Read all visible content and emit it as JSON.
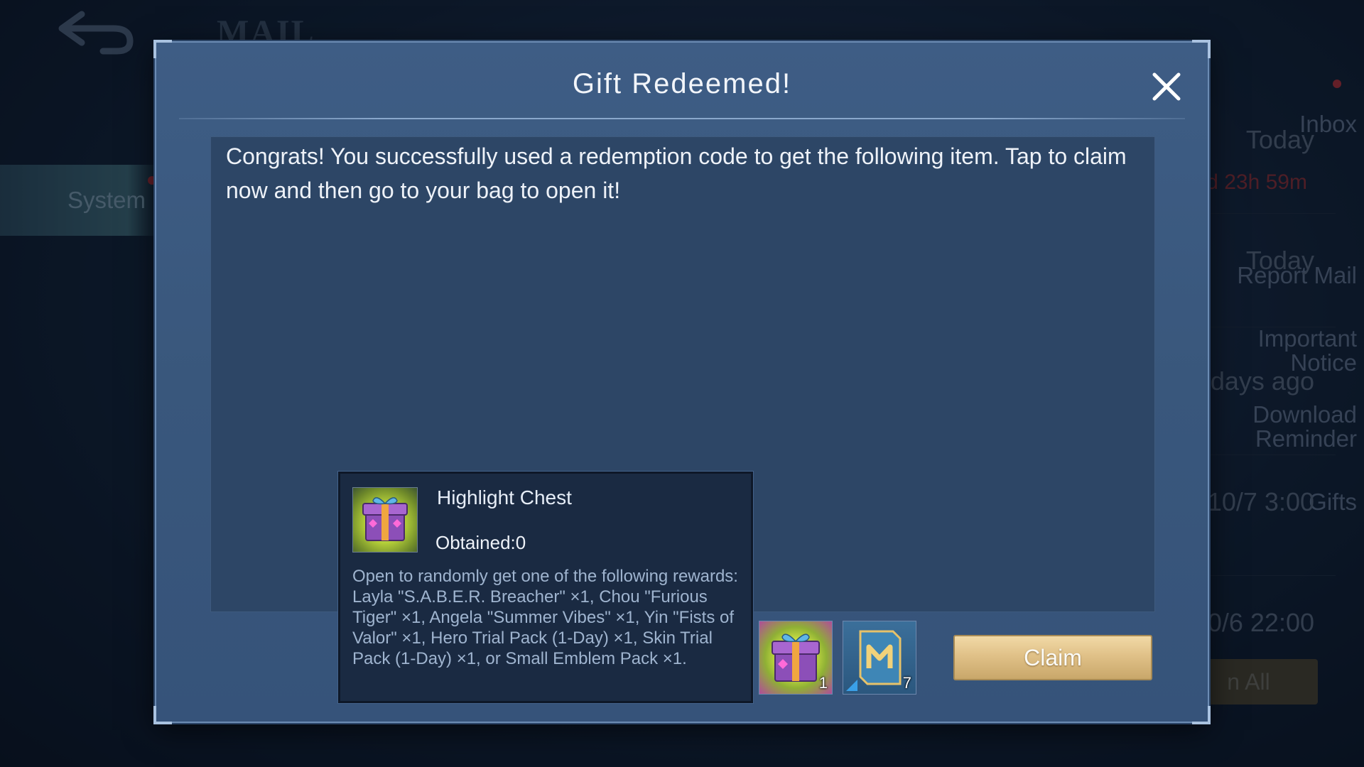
{
  "background": {
    "screen_title": "MAIL",
    "sidebar": [
      {
        "label": "Inbox",
        "active": false
      },
      {
        "label": "System",
        "active": true
      },
      {
        "label": "Report Mail",
        "active": false
      },
      {
        "label": "Important Notice",
        "active": false
      },
      {
        "label": "Download Reminder",
        "active": false
      },
      {
        "label": "Gifts",
        "active": false
      }
    ],
    "mail_times": [
      "Today",
      "d 23h 59m",
      "Today",
      "days ago",
      "10/7 3:00",
      "0/6 22:00"
    ],
    "claim_all_label": "n All"
  },
  "dialog": {
    "title": "Gift Redeemed!",
    "message": "Congrats! You successfully used a redemption code to get the following item. Tap to claim now and then go to your bag to open it!",
    "claim_label": "Claim"
  },
  "tooltip": {
    "item_name": "Highlight Chest",
    "obtained": "Obtained:0",
    "description": "Open to randomly get one of the following rewards: Layla \"S.A.B.E.R. Breacher\" ×1, Chou \"Furious Tiger\" ×1, Angela \"Summer Vibes\" ×1, Yin \"Fists of Valor\" ×1, Hero Trial Pack (1-Day) ×1, Skin Trial Pack (1-Day) ×1, or Small Emblem Pack ×1."
  },
  "rewards": [
    {
      "icon": "highlight-chest-icon",
      "quantity": "1"
    },
    {
      "icon": "emblem-card-icon",
      "quantity": "7"
    }
  ],
  "colors": {
    "accent_gold": "#e0c188",
    "panel_blue": "#3e5d85",
    "alert_red": "#b3303a"
  }
}
